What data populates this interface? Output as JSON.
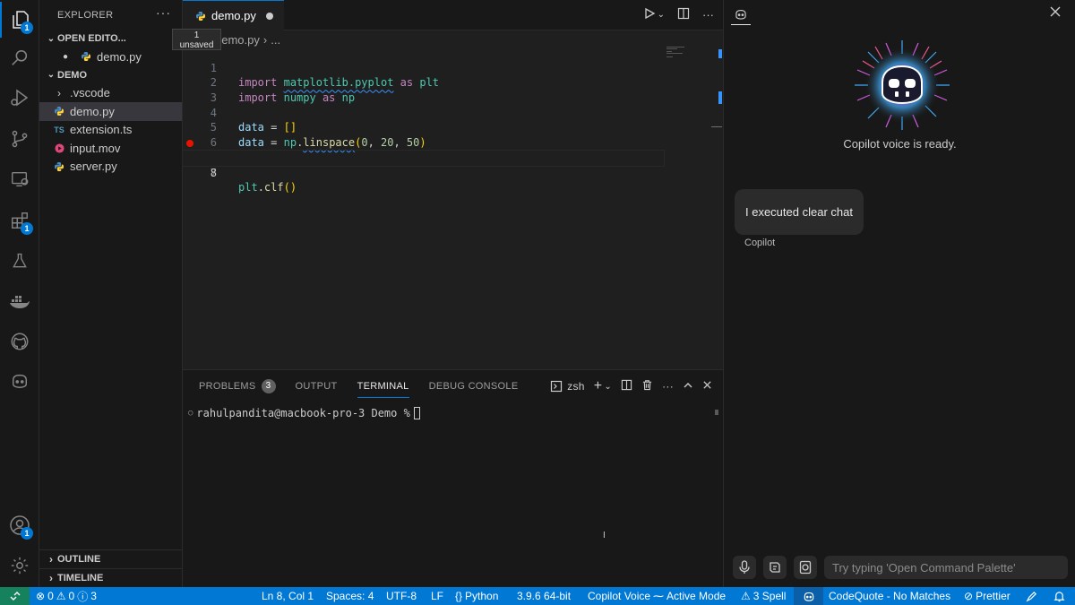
{
  "activity_bar": {
    "explorer_badge": "1",
    "extensions_badge": "1",
    "accounts_badge": "1"
  },
  "sidebar": {
    "header": "EXPLORER",
    "open_editors": {
      "label": "OPEN EDITO...",
      "tooltip_line1": "1",
      "tooltip_line2": "unsaved",
      "files": [
        "demo.py"
      ]
    },
    "folder": {
      "label": "DEMO",
      "items": [
        {
          "name": ".vscode",
          "icon": "chevron-right-icon"
        },
        {
          "name": "demo.py",
          "icon": "python-icon"
        },
        {
          "name": "extension.ts",
          "icon": "ts-icon",
          "icon_text": "TS"
        },
        {
          "name": "input.mov",
          "icon": "media-icon"
        },
        {
          "name": "server.py",
          "icon": "python-icon"
        }
      ]
    },
    "outline_label": "OUTLINE",
    "timeline_label": "TIMELINE"
  },
  "editor": {
    "tab_label": "demo.py",
    "breadcrumb_file": "demo.py",
    "breadcrumb_more": "...",
    "line_numbers": [
      "1",
      "2",
      "3",
      "4",
      "5",
      "6",
      "7",
      "8"
    ],
    "code_lines": [
      "import matplotlib.pyplot as plt",
      "import numpy as np",
      "",
      "data = []",
      "data = np.linspace(0, 20, 50)",
      "",
      "plt.clf()",
      ""
    ]
  },
  "panel": {
    "tabs": {
      "problems": "PROBLEMS",
      "problems_count": "3",
      "output": "OUTPUT",
      "terminal": "TERMINAL",
      "debug_console": "DEBUG CONSOLE"
    },
    "shell": "zsh",
    "terminal_prompt": "rahulpandita@macbook-pro-3 Demo % "
  },
  "copilot": {
    "status": "Copilot voice is ready.",
    "message": "I executed clear chat",
    "author": "Copilot",
    "input_placeholder": "Try typing 'Open Command Palette'"
  },
  "statusbar": {
    "errors": "0",
    "warnings": "0",
    "infos": "3",
    "position": "Ln 8, Col 1",
    "spaces": "Spaces: 4",
    "encoding": "UTF-8",
    "eol": "LF",
    "language": "Python",
    "interpreter": "3.9.6 64-bit",
    "copilot_voice": "Copilot Voice",
    "mode": "Active Mode",
    "spell": "3 Spell",
    "codequote": "CodeQuote - No Matches",
    "prettier": "Prettier"
  },
  "colors": {
    "accent": "#0078d4",
    "statusbar": "#0078d4",
    "remote": "#16825d",
    "breakpoint": "#e51400"
  }
}
